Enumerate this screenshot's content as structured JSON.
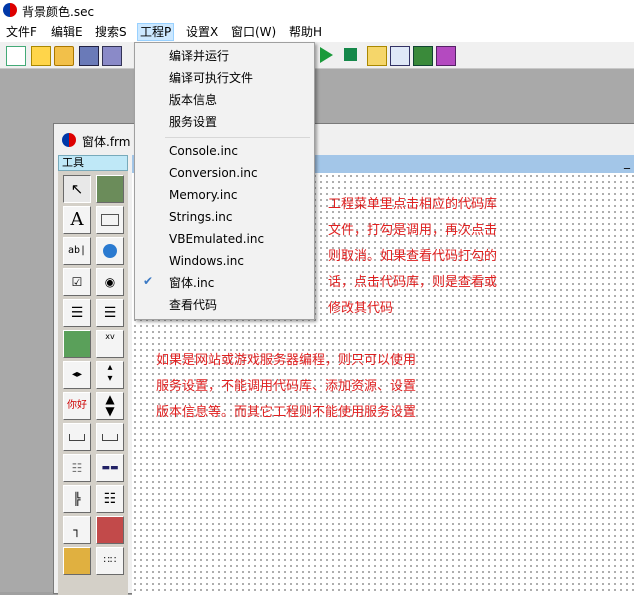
{
  "window": {
    "title": "背景颜色.sec"
  },
  "menubar": {
    "items": [
      "文件F",
      "编辑E",
      "搜索S",
      "工程P",
      "设置X",
      "窗口(W)",
      "帮助H"
    ],
    "active": "工程P"
  },
  "toolbar": {
    "icons": [
      "new-file-icon",
      "new-form-icon",
      "open-folder-icon",
      "save-icon",
      "save-all-icon",
      "run-icon",
      "stop-icon",
      "import-icon",
      "properties-icon",
      "build-icon",
      "books-icon"
    ]
  },
  "project_menu": {
    "items": [
      "编译并运行",
      "编译可执行文件",
      "版本信息",
      "服务设置"
    ],
    "libraries": [
      "Console.inc",
      "Conversion.inc",
      "Memory.inc",
      "Strings.inc",
      "VBEmulated.inc",
      "Windows.inc",
      "窗体.inc"
    ],
    "checked": "窗体.inc",
    "view_code": "查看代码"
  },
  "child_window": {
    "title": "窗体.frm",
    "toolbox_title": "工具",
    "minimize_glyph": "_"
  },
  "toolbox": {
    "tools": [
      "pointer-tool-icon",
      "picture-tool-icon",
      "label-tool-icon",
      "frame-tool-icon",
      "textbox-tool-icon",
      "web-tool-icon",
      "checkbox-tool-icon",
      "radio-tool-icon",
      "listbox-tool-icon",
      "combobox-tool-icon",
      "image-tool-icon",
      "xv-tool-icon",
      "hscroll-tool-icon",
      "vscroll-tool-icon",
      "speech-bubble-tool-icon",
      "updown-tool-icon",
      "tab-tool-icon",
      "toggle-tool-icon",
      "grid-tool-icon",
      "progress-tool-icon",
      "tree-tool-icon",
      "list-view-tool-icon",
      "line-chart-tool-icon",
      "chart-tool-icon",
      "pic-tool-icon",
      "dots-tool-icon"
    ],
    "label_glyph": "A",
    "textbox_glyph": "ab|",
    "bubble_glyph": "你好",
    "xv_glyph": "xv"
  },
  "notes": {
    "top": "工程菜单里点击相应的代码库\n文件，打勾是调用，再次点击\n则取消。如果查看代码打勾的\n话，点击代码库，则是查看或\n修改其代码",
    "bottom": "如果是网站或游戏服务器编程，则只可以使用\n服务设置，不能调用代码库、添加资源、设置\n版本信息等。而其它工程则不能使用服务设置"
  },
  "colors": {
    "note_text": "#e02020",
    "toolbox_header": "#bfe8f7",
    "form_header": "#a3c6e8"
  }
}
